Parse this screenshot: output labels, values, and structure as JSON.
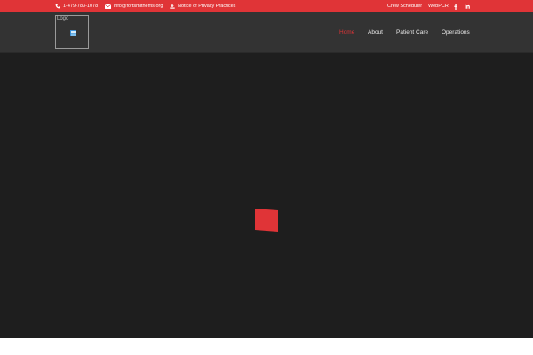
{
  "topbar": {
    "phone": "1-479-783-1078",
    "email": "info@fortsmithems.org",
    "privacy": "Notice of Privacy Practices",
    "links": [
      "Crew Scheduler",
      "WebPCR"
    ],
    "social_icons": [
      "facebook-icon",
      "linkedin-icon"
    ],
    "background_color": "#e03437"
  },
  "header": {
    "logo_alt": "Logo",
    "nav": [
      {
        "label": "Home",
        "active": true
      },
      {
        "label": "About",
        "active": false
      },
      {
        "label": "Patient Care",
        "active": false
      },
      {
        "label": "Operations",
        "active": false
      }
    ],
    "accent_color": "#e03437"
  },
  "hero": {
    "background_color": "#1e1e1e",
    "loader_color": "#e03437"
  }
}
